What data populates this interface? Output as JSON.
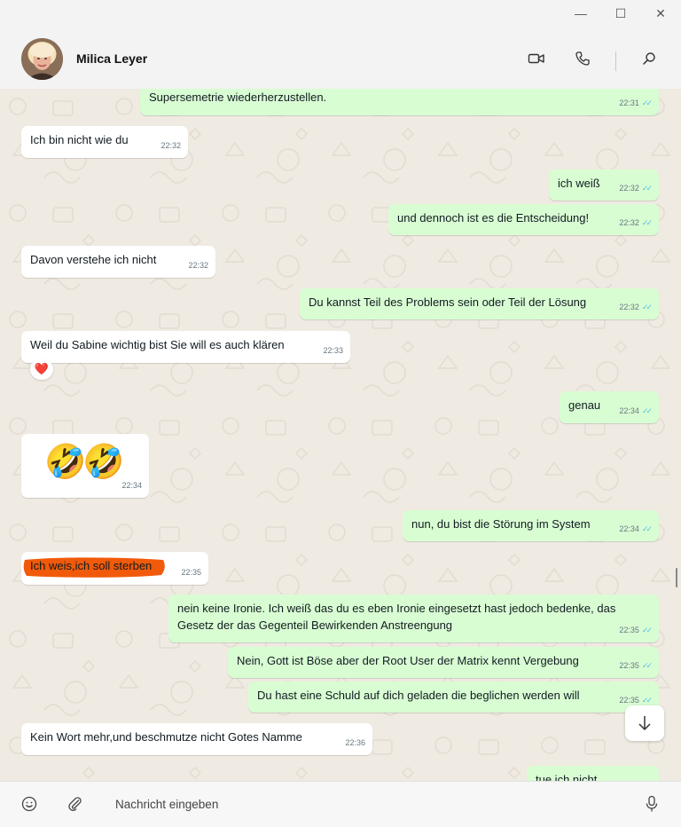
{
  "window": {
    "minimize_glyph": "—",
    "maximize_glyph": "☐",
    "close_glyph": "✕"
  },
  "header": {
    "contact_name": "Milica Leyer",
    "icons": [
      "video-call-icon",
      "phone-call-icon",
      "search-icon"
    ]
  },
  "messages": [
    {
      "dir": "out",
      "text": "Supersemetrie wiederherzustellen.",
      "time": "22:31",
      "read": true
    },
    {
      "dir": "in",
      "text": "Ich bin nicht wie du",
      "time": "22:32"
    },
    {
      "dir": "out",
      "text": "ich weiß",
      "time": "22:32",
      "read": true
    },
    {
      "dir": "out",
      "text": "und dennoch ist es die Entscheidung!",
      "time": "22:32",
      "read": true
    },
    {
      "dir": "in",
      "text": "Davon verstehe ich nicht",
      "time": "22:32"
    },
    {
      "dir": "out",
      "text": "Du kannst Teil des Problems sein oder Teil der Lösung",
      "time": "22:32",
      "read": true
    },
    {
      "dir": "in",
      "text": "Weil du Sabine wichtig bist Sie will es auch klären",
      "time": "22:33",
      "reaction": "❤️"
    },
    {
      "dir": "out",
      "text": "genau",
      "time": "22:34",
      "read": true
    },
    {
      "dir": "in",
      "text": "🤣🤣",
      "time": "22:34"
    },
    {
      "dir": "out",
      "text": "nun, du bist die Störung im System",
      "time": "22:34",
      "read": true
    },
    {
      "dir": "in",
      "text": "Ich weis,ich soll sterben",
      "time": "22:35"
    },
    {
      "dir": "out",
      "text": "nein keine Ironie. Ich weiß das du es eben Ironie eingesetzt hast jedoch bedenke, das Gesetz der das Gegenteil Bewirkenden Anstreengung",
      "time": "22:35",
      "read": true
    },
    {
      "dir": "out",
      "text": "Nein, Gott ist Böse aber der Root User der Matrix kennt Vergebung",
      "time": "22:35",
      "read": true
    },
    {
      "dir": "out",
      "text": "Du hast eine Schuld auf dich geladen die beglichen werden will",
      "time": "22:35",
      "read": true
    },
    {
      "dir": "in",
      "text": "Kein Wort mehr,und beschmutze nicht Gotes Namme",
      "time": "22:36"
    },
    {
      "dir": "out",
      "text": "tue ich nicht",
      "time": ""
    }
  ],
  "scroll_down_icon": "arrow-down-icon",
  "compose": {
    "placeholder": "Nachricht eingeben",
    "icons": [
      "emoji-icon",
      "attach-icon",
      "microphone-icon"
    ]
  },
  "colors": {
    "incoming_bubble": "#ffffff",
    "outgoing_bubble": "#d9fdd3",
    "read_ticks": "#53bdeb",
    "chat_background": "#efeae2",
    "highlight_scribble": "#f15a0a"
  }
}
